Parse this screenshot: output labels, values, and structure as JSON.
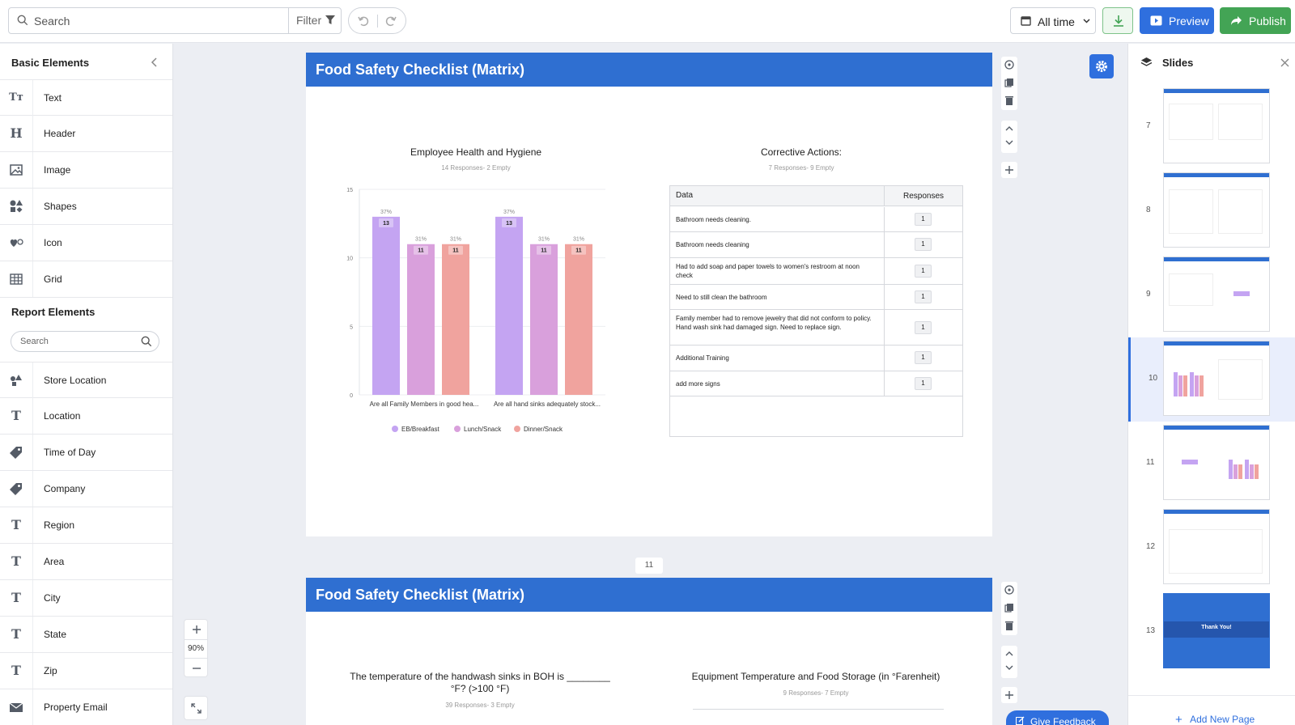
{
  "topbar": {
    "search_placeholder": "Search",
    "filter_label": "Filter",
    "time_range": "All time",
    "preview_label": "Preview",
    "publish_label": "Publish"
  },
  "left_panel": {
    "basic_title": "Basic Elements",
    "basic_items": [
      {
        "label": "Text",
        "icon": "text-size-icon"
      },
      {
        "label": "Header",
        "icon": "header-icon"
      },
      {
        "label": "Image",
        "icon": "image-icon"
      },
      {
        "label": "Shapes",
        "icon": "shapes-icon"
      },
      {
        "label": "Icon",
        "icon": "heart-icon"
      },
      {
        "label": "Grid",
        "icon": "grid-icon"
      }
    ],
    "report_title": "Report Elements",
    "report_search_placeholder": "Search",
    "report_items": [
      {
        "label": "Store Location",
        "icon": "store-location-icon"
      },
      {
        "label": "Location",
        "icon": "text-icon"
      },
      {
        "label": "Time of Day",
        "icon": "tag-icon"
      },
      {
        "label": "Company",
        "icon": "tag-icon"
      },
      {
        "label": "Region",
        "icon": "text-icon"
      },
      {
        "label": "Area",
        "icon": "text-icon"
      },
      {
        "label": "City",
        "icon": "text-icon"
      },
      {
        "label": "State",
        "icon": "text-icon"
      },
      {
        "label": "Zip",
        "icon": "text-icon"
      },
      {
        "label": "Property Email",
        "icon": "mail-icon"
      }
    ]
  },
  "slide1": {
    "title": "Food Safety Checklist (Matrix)",
    "chart_title": "Employee Health and Hygiene",
    "chart_subtitle": "14 Responses- 2 Empty",
    "table_title": "Corrective Actions:",
    "table_subtitle": "7 Responses- 9 Empty",
    "table": {
      "headers": [
        "Data",
        "Responses"
      ],
      "rows": [
        {
          "text": "Bathroom needs cleaning.",
          "count": "1"
        },
        {
          "text": "Bathroom needs cleaning",
          "count": "1"
        },
        {
          "text": "Had to add soap and paper towels to women's restroom at noon check",
          "count": "1"
        },
        {
          "text": "Need to still clean the bathroom",
          "count": "1"
        },
        {
          "text": "Family member had to remove jewelry that did not conform to policy. Hand wash sink had damaged sign. Need to replace sign.",
          "count": "1"
        },
        {
          "text": "Additional Training",
          "count": "1"
        },
        {
          "text": "add more signs",
          "count": "1"
        }
      ]
    }
  },
  "page_number": "11",
  "slide2": {
    "title": "Food Safety Checklist (Matrix)",
    "left_title": "The temperature of the handwash sinks in BOH is ________ °F? (>100 °F)",
    "left_subtitle": "39 Responses- 3 Empty",
    "right_title": "Equipment Temperature and Food Storage (in °Farenheit)",
    "right_subtitle": "9 Responses- 7 Empty"
  },
  "zoom": {
    "level": "90%"
  },
  "slides_panel": {
    "title": "Slides",
    "numbers": [
      "7",
      "8",
      "9",
      "10",
      "11",
      "12",
      "13"
    ],
    "active": "10",
    "thank_you": "Thank You!",
    "add_page": "Add New Page"
  },
  "feedback_label": "Give Feedback",
  "colors": {
    "accent": "#2f6fde",
    "header": "#2f6fd1",
    "publish": "#43a455",
    "eb": "#c4a4f2",
    "lunch": "#d9a0dc",
    "dinner": "#f0a39e"
  },
  "chart_data": {
    "type": "bar",
    "title": "Employee Health and Hygiene",
    "subtitle": "14 Responses- 2 Empty",
    "categories": [
      "Are all Family Members in good hea...",
      "Are all hand sinks adequately stock..."
    ],
    "series": [
      {
        "name": "EB/Breakfast",
        "values": [
          13,
          13
        ],
        "labels": [
          "37%",
          "37%"
        ]
      },
      {
        "name": "Lunch/Snack",
        "values": [
          11,
          11
        ],
        "labels": [
          "31%",
          "31%"
        ]
      },
      {
        "name": "Dinner/Snack",
        "values": [
          11,
          11
        ],
        "labels": [
          "31%",
          "31%"
        ]
      }
    ],
    "yticks": [
      0,
      5,
      10,
      15
    ],
    "ylim": [
      0,
      15
    ],
    "legend": "bottom",
    "grid": true
  }
}
